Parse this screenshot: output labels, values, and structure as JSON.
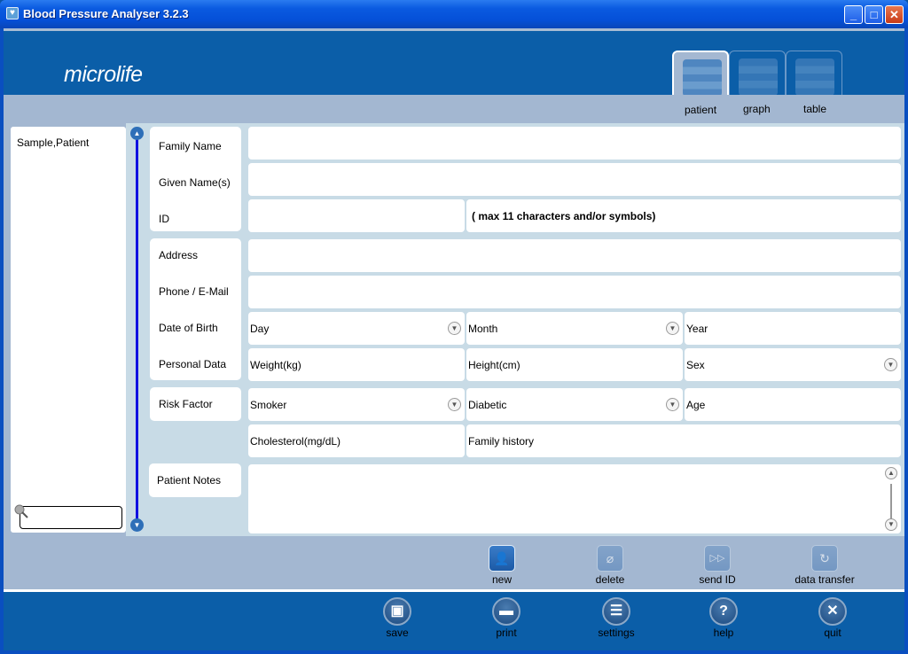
{
  "window": {
    "title": "Blood Pressure Analyser 3.2.3",
    "controls": {
      "minimize": "_",
      "maximize": "□",
      "close": "✕"
    }
  },
  "header": {
    "logo": "microlife",
    "tabs": [
      {
        "label": "patient",
        "icon": "patient-icon",
        "active": true
      },
      {
        "label": "graph",
        "icon": "graph-icon",
        "active": false
      },
      {
        "label": "table",
        "icon": "table-icon",
        "active": false
      }
    ]
  },
  "sidebar": {
    "patients": [
      "Sample,Patient"
    ],
    "search": {
      "value": "",
      "placeholder": ""
    }
  },
  "form": {
    "labels": {
      "family_name": "Family Name",
      "given_names": "Given Name(s)",
      "id": "ID",
      "address": "Address",
      "phone_email": "Phone / E-Mail",
      "date_of_birth": "Date of Birth",
      "personal_data": "Personal Data",
      "risk_factor": "Risk Factor",
      "patient_notes": "Patient Notes"
    },
    "fields": {
      "family_name": "",
      "given_names": "",
      "id": "",
      "id_hint": "( max 11 characters and/or symbols)",
      "address": "",
      "phone_email": "",
      "dob_day": "Day",
      "dob_month": "Month",
      "dob_year": "Year",
      "weight": "Weight(kg)",
      "height": "Height(cm)",
      "sex": "Sex",
      "smoker": "Smoker",
      "diabetic": "Diabetic",
      "age": "Age",
      "cholesterol": "Cholesterol(mg/dL)",
      "family_history": "Family history",
      "notes": ""
    }
  },
  "actions": [
    {
      "label": "new",
      "icon": "new-patient-icon",
      "enabled": true
    },
    {
      "label": "delete",
      "icon": "delete-patient-icon",
      "enabled": false
    },
    {
      "label": "send ID",
      "icon": "send-id-icon",
      "enabled": false
    },
    {
      "label": "data transfer",
      "icon": "data-transfer-icon",
      "enabled": false
    }
  ],
  "bottom": [
    {
      "label": "save",
      "icon": "save-icon"
    },
    {
      "label": "print",
      "icon": "print-icon"
    },
    {
      "label": "settings",
      "icon": "settings-icon"
    },
    {
      "label": "help",
      "icon": "help-icon"
    },
    {
      "label": "quit",
      "icon": "quit-icon"
    }
  ],
  "glyphs": {
    "dropdown": "▼",
    "scroll_up": "▲",
    "scroll_down": "▼",
    "new": "👤",
    "delete": "⌀",
    "send": "▷▷",
    "transfer": "↻",
    "save": "▣",
    "print": "▬",
    "settings": "☰",
    "help": "?",
    "quit": "✕",
    "title_icon": "♥"
  }
}
